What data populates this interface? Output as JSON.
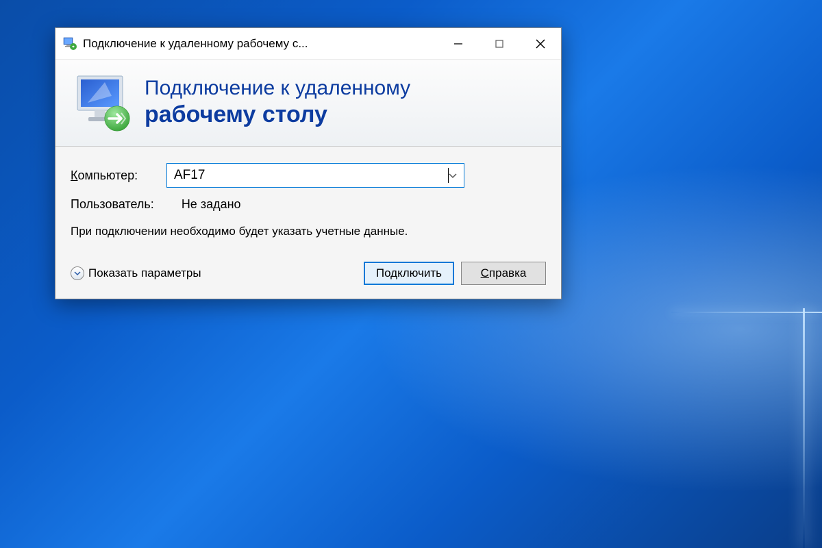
{
  "window": {
    "title": "Подключение к удаленному рабочему с..."
  },
  "banner": {
    "line1": "Подключение к удаленному",
    "line2": "рабочему столу"
  },
  "form": {
    "computer_label_underline": "К",
    "computer_label_rest": "омпьютер:",
    "computer_value": "AF17",
    "user_label": "Пользователь:",
    "user_value": "Не задано",
    "hint": "При подключении необходимо будет указать учетные данные."
  },
  "footer": {
    "expand_underline": "П",
    "expand_rest": "оказать параметры",
    "connect_label": "Подключить",
    "help_underline": "С",
    "help_rest": "правка"
  }
}
